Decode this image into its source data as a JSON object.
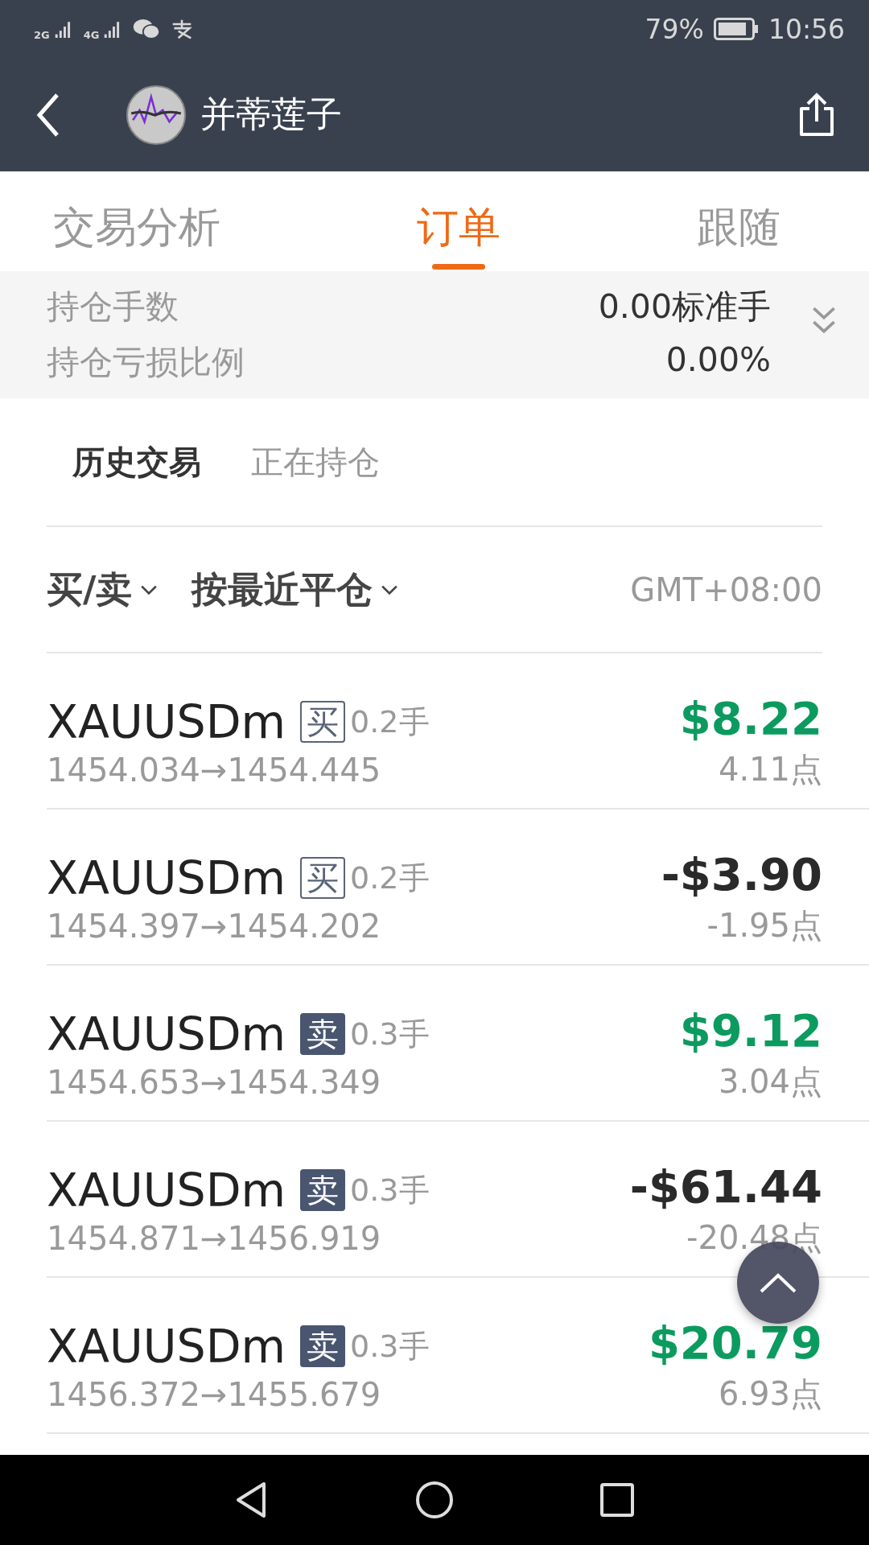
{
  "status_bar": {
    "networks": [
      "2G",
      "4G"
    ],
    "battery": "79%",
    "time": "10:56"
  },
  "header": {
    "title": "并蒂莲子"
  },
  "tabs": [
    {
      "label": "交易分析",
      "selected": false
    },
    {
      "label": "订单",
      "selected": true
    },
    {
      "label": "跟随",
      "selected": false
    }
  ],
  "summary": [
    {
      "label": "持仓手数",
      "value": "0.00标准手"
    },
    {
      "label": "持仓亏损比例",
      "value": "0.00%"
    }
  ],
  "sub_tabs": [
    {
      "label": "历史交易",
      "selected": true
    },
    {
      "label": "正在持仓",
      "selected": false
    }
  ],
  "filters": [
    "买/卖",
    "按最近平仓"
  ],
  "timezone": "GMT+08:00",
  "orders": [
    {
      "symbol": "XAUUSDm",
      "side": "买",
      "kind": "buy",
      "lots": "0.2手",
      "prices": "1454.034→1454.445",
      "amount": "$8.22",
      "points": "4.11点",
      "positive": true
    },
    {
      "symbol": "XAUUSDm",
      "side": "买",
      "kind": "buy",
      "lots": "0.2手",
      "prices": "1454.397→1454.202",
      "amount": "-$3.90",
      "points": "-1.95点",
      "positive": false
    },
    {
      "symbol": "XAUUSDm",
      "side": "卖",
      "kind": "sell",
      "lots": "0.3手",
      "prices": "1454.653→1454.349",
      "amount": "$9.12",
      "points": "3.04点",
      "positive": true
    },
    {
      "symbol": "XAUUSDm",
      "side": "卖",
      "kind": "sell",
      "lots": "0.3手",
      "prices": "1454.871→1456.919",
      "amount": "-$61.44",
      "points": "-20.48点",
      "positive": false
    },
    {
      "symbol": "XAUUSDm",
      "side": "卖",
      "kind": "sell",
      "lots": "0.3手",
      "prices": "1456.372→1455.679",
      "amount": "$20.79",
      "points": "6.93点",
      "positive": true
    }
  ]
}
